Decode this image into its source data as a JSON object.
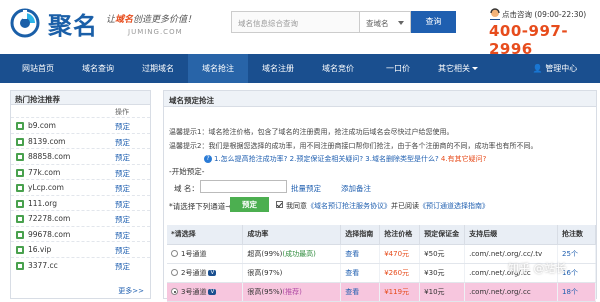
{
  "header": {
    "logo_name": "聚名",
    "slogan_prefix": "让",
    "slogan_highlight": "域名",
    "slogan_rest": "创造更多价值！",
    "logo_url": "JUMING.COM",
    "search_placeholder": "域名信息综合查询",
    "search_select": "查域名",
    "search_button": "查询",
    "service_label": "点击咨询 (09:00-22:30)",
    "phone": "400-997-2996"
  },
  "nav": {
    "items": [
      {
        "label": "网站首页"
      },
      {
        "label": "域名查询"
      },
      {
        "label": "过期域名"
      },
      {
        "label": "域名抢注"
      },
      {
        "label": "域名注册"
      },
      {
        "label": "域名竞价"
      },
      {
        "label": "一口价"
      },
      {
        "label": "其它相关"
      },
      {
        "label": "管理中心"
      }
    ]
  },
  "left_panel": {
    "title": "热门抢注推荐",
    "col_op": "操作",
    "rows": [
      {
        "domain": "b9.com",
        "op": "预定"
      },
      {
        "domain": "8139.com",
        "op": "预定"
      },
      {
        "domain": "88858.com",
        "op": "预定"
      },
      {
        "domain": "77k.com",
        "op": "预定"
      },
      {
        "domain": "yLcp.com",
        "op": "预定"
      },
      {
        "domain": "111.org",
        "op": "预定"
      },
      {
        "domain": "72278.com",
        "op": "预定"
      },
      {
        "domain": "99678.com",
        "op": "预定"
      },
      {
        "domain": "16.vip",
        "op": "预定"
      },
      {
        "domain": "3377.cc",
        "op": "预定"
      }
    ],
    "more": "更多>>"
  },
  "main": {
    "title": "域名预定抢注",
    "tip1": "温馨提示1：域名抢注价格，包含了域名的注册费用，抢注成功后域名会尽快过户给您使用。",
    "tip2": "温馨提示2：我们是根据您选择的成功率，用不同注册商接口帮你们抢注，由于各个注册商的不同，成功率也有所不同。",
    "q1": "1.怎么提高抢注成功率?",
    "q2": "2.预定保证金相关疑问?",
    "q3": "3.域名删除类型是什么?",
    "q4": "4.有其它疑问?",
    "single_label": "-开始预定-",
    "domain_label": "域 名：",
    "batch_link": "批量预定",
    "fav_link": "添加备注",
    "choose_label": "*请选择下列通道→",
    "submit_button": "预定",
    "agree_text": "我同意",
    "agree_link1": "《域名预订抢注服务协议》",
    "agree_mid": "并已阅读",
    "agree_link2": "《预订通道选择指南》"
  },
  "table": {
    "headers": [
      "*请选择",
      "成功率",
      "选择指南",
      "抢注价格",
      "预定保证金",
      "支持后缀",
      "抢注数"
    ],
    "rows": [
      {
        "channel": "1号通道",
        "vip": false,
        "rate": "超高(99%)",
        "rate_note": "(成功最高)",
        "guide": "查看",
        "price": "¥470元",
        "deposit": "¥50元",
        "suffix": ".com/.net/.org/.cc/.tv",
        "count": "25个"
      },
      {
        "channel": "2号通道",
        "vip": true,
        "rate": "很高(97%)",
        "rate_note": "",
        "guide": "查看",
        "price": "¥260元",
        "deposit": "¥30元",
        "suffix": ".com/.net/.org/.cc",
        "count": "16个"
      },
      {
        "channel": "3号通道",
        "vip": true,
        "rate": "很高(95%)",
        "rate_note": "(推荐)",
        "guide": "查看",
        "price": "¥119元",
        "deposit": "¥10元",
        "suffix": ".com/.net/.org/.cc",
        "count": "18个"
      }
    ]
  },
  "watermark": "知乎 @站长",
  "colors": {
    "brand_blue": "#1a4f8f",
    "accent_red": "#e74c1c",
    "green": "#4caf50"
  }
}
